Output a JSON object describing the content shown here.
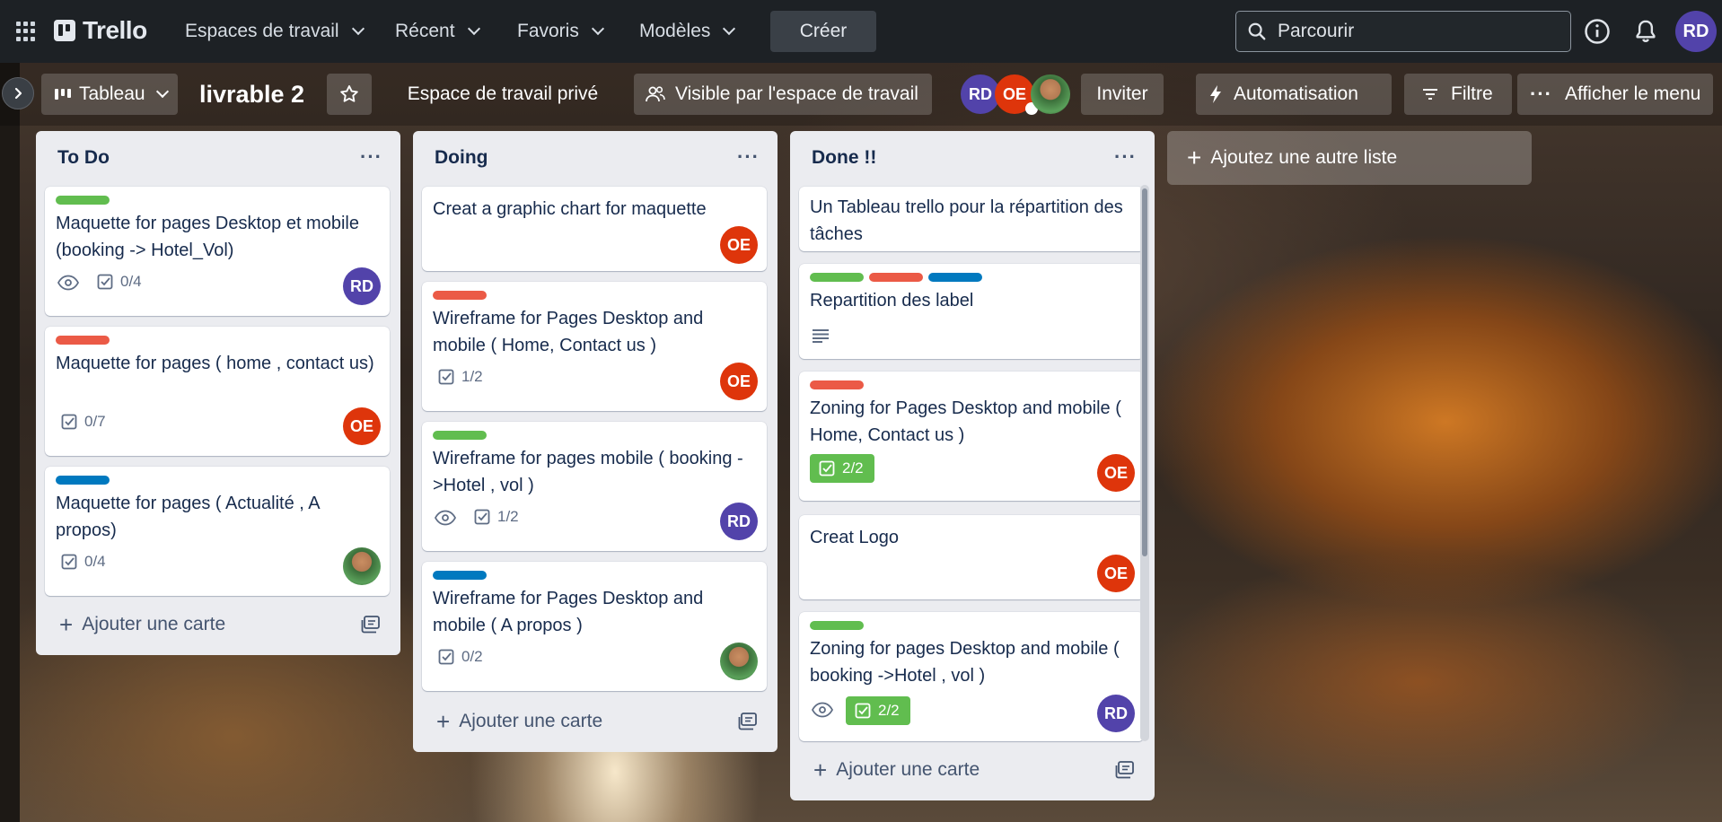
{
  "topnav": {
    "logo": "Trello",
    "menus": [
      "Espaces de travail",
      "Récent",
      "Favoris",
      "Modèles"
    ],
    "create_label": "Créer",
    "search_placeholder": "Parcourir",
    "user_initials": "RD"
  },
  "board": {
    "view_label": "Tableau",
    "title": "livrable 2",
    "workspace_label": "Espace de travail privé",
    "visibility_label": "Visible par l'espace de travail",
    "members": [
      "RD",
      "OE"
    ],
    "invite_label": "Inviter",
    "automation_label": "Automatisation",
    "filter_label": "Filtre",
    "menu_label": "Afficher le menu"
  },
  "lists": [
    {
      "title": "To Do",
      "add_card": "Ajouter une carte",
      "cards": [
        {
          "title": "Maquette for pages Desktop et mobile (booking -> Hotel_Vol)",
          "checklist": "0/4",
          "member": "RD"
        },
        {
          "title": "Maquette for pages ( home , contact us)",
          "checklist": "0/7",
          "member": "OE"
        },
        {
          "title": "Maquette for pages ( Actualité , A propos)",
          "checklist": "0/4"
        }
      ]
    },
    {
      "title": "Doing",
      "add_card": "Ajouter une carte",
      "cards": [
        {
          "title": "Creat a graphic chart for maquette",
          "member": "OE"
        },
        {
          "title": "Wireframe for Pages Desktop and mobile ( Home, Contact us )",
          "checklist": "1/2",
          "member": "OE"
        },
        {
          "title": "Wireframe for pages mobile ( booking ->Hotel , vol )",
          "checklist": "1/2",
          "member": "RD"
        },
        {
          "title": "Wireframe for Pages Desktop and mobile ( A propos )",
          "checklist": "0/2"
        }
      ]
    },
    {
      "title": "Done !!",
      "add_card": "Ajouter une carte",
      "cards": [
        {
          "title": "Un Tableau trello pour la répartition des tâches"
        },
        {
          "title": "Repartition des label"
        },
        {
          "title": "Zoning for Pages Desktop and mobile ( Home, Contact us )",
          "checklist": "2/2",
          "member": "OE"
        },
        {
          "title": "Creat Logo",
          "member": "OE"
        },
        {
          "title": "Zoning for pages Desktop and mobile ( booking ->Hotel , vol )",
          "checklist": "2/2",
          "member": "RD"
        }
      ]
    }
  ],
  "add_list_label": "Ajoutez une autre liste",
  "colors": {
    "label_green": "#61bd4f",
    "label_red": "#eb5a46",
    "label_blue": "#0079bf",
    "member_rd": "#5243aa",
    "member_oe": "#de350b"
  }
}
